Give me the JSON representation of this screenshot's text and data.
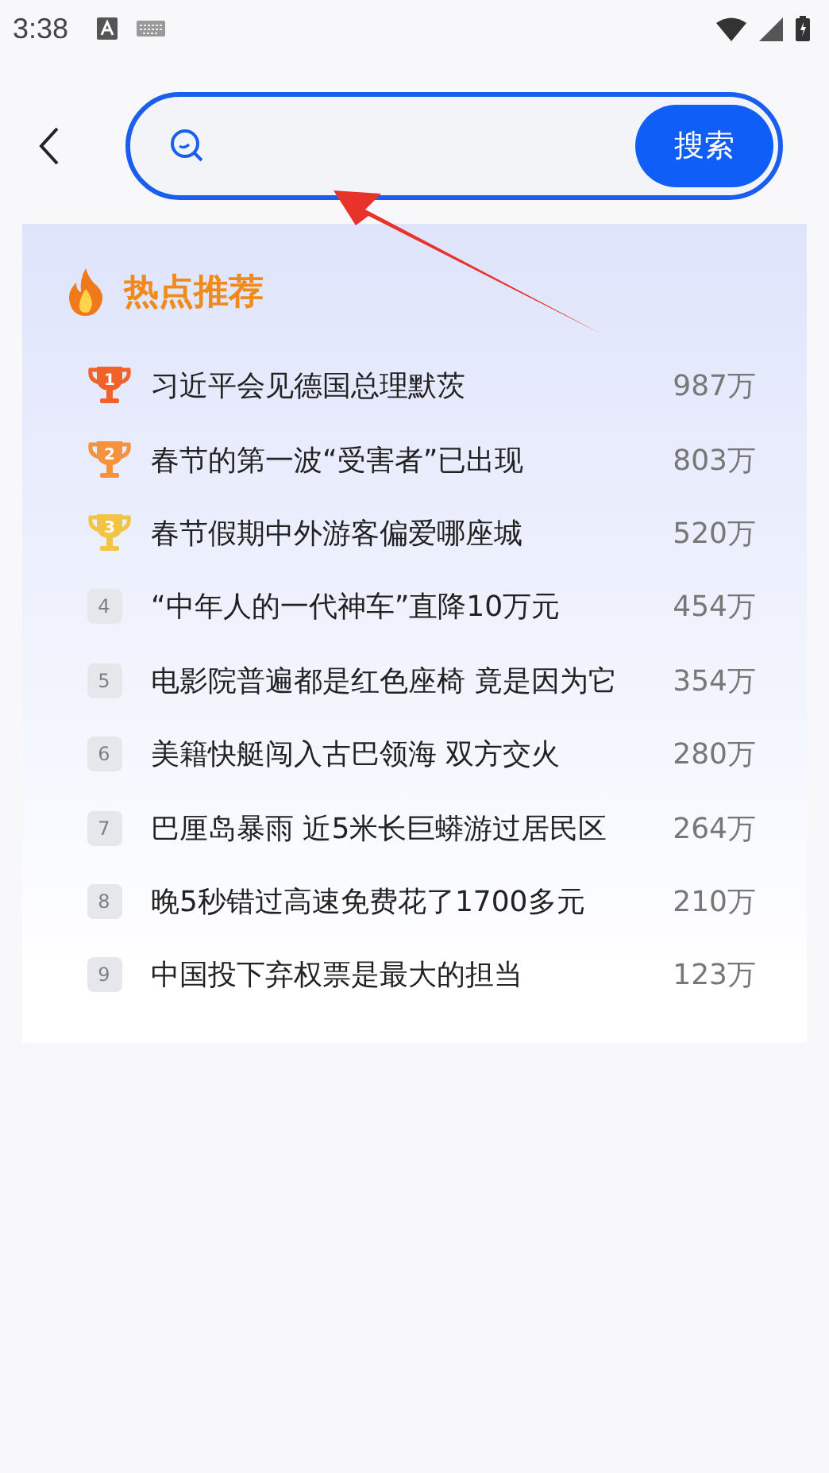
{
  "status_bar": {
    "time": "3:38"
  },
  "search": {
    "button": "搜索"
  },
  "hot": {
    "title": "热点推荐",
    "items": [
      {
        "rank": "1",
        "kind": "trophy",
        "color": "#f0622a",
        "title": "习近平会见德国总理默茨",
        "count": "987万"
      },
      {
        "rank": "2",
        "kind": "trophy",
        "color": "#f5923e",
        "title": "春节的第一波“受害者”已出现",
        "count": "803万"
      },
      {
        "rank": "3",
        "kind": "trophy",
        "color": "#f3c443",
        "title": "春节假期中外游客偏爱哪座城",
        "count": "520万"
      },
      {
        "rank": "4",
        "kind": "plain",
        "title": "“中年人的一代神车”直降10万元",
        "count": "454万"
      },
      {
        "rank": "5",
        "kind": "plain",
        "title": "电影院普遍都是红色座椅 竟是因为它",
        "count": "354万"
      },
      {
        "rank": "6",
        "kind": "plain",
        "title": "美籍快艇闯入古巴领海 双方交火",
        "count": "280万"
      },
      {
        "rank": "7",
        "kind": "plain",
        "title": "巴厘岛暴雨 近5米长巨蟒游过居民区",
        "count": "264万"
      },
      {
        "rank": "8",
        "kind": "plain",
        "title": "晚5秒错过高速免费花了1700多元",
        "count": "210万"
      },
      {
        "rank": "9",
        "kind": "plain",
        "title": "中国投下弃权票是最大的担当",
        "count": "123万"
      }
    ]
  }
}
